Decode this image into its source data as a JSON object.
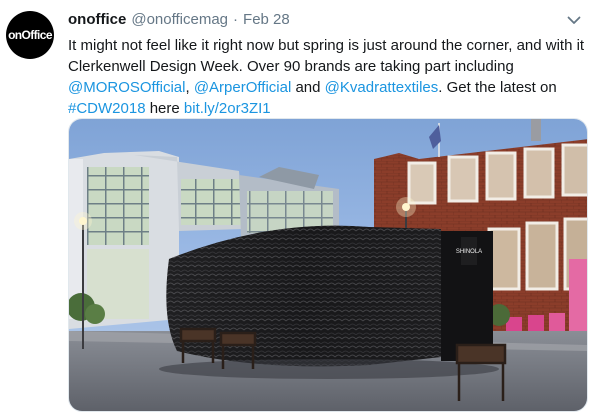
{
  "tweet": {
    "avatar_text": "onOffice",
    "display_name": "onoffice",
    "handle": "@onofficemag",
    "separator": "·",
    "timestamp": "Feb 28",
    "text_part1": "It might not feel like it right now but spring is just around the corner, and with it Clerkenwell Design Week. Over 90 brands are taking part including ",
    "mention_1": "@MOROSOfficial",
    "comma_1": ", ",
    "mention_2": "@ArperOfficial",
    "and_text": " and ",
    "mention_3": "@Kvadrattextiles",
    "text_part2": ". Get the latest on ",
    "hashtag": "#CDW2018",
    "here_text": " here ",
    "link": "bit.ly/2or3ZI1",
    "kiosk_sign": "SHINOLA"
  },
  "colors": {
    "link": "#1b95e0",
    "secondary": "#657786",
    "primary": "#14171a"
  },
  "icons": {
    "menu": "chevron-down-icon"
  }
}
